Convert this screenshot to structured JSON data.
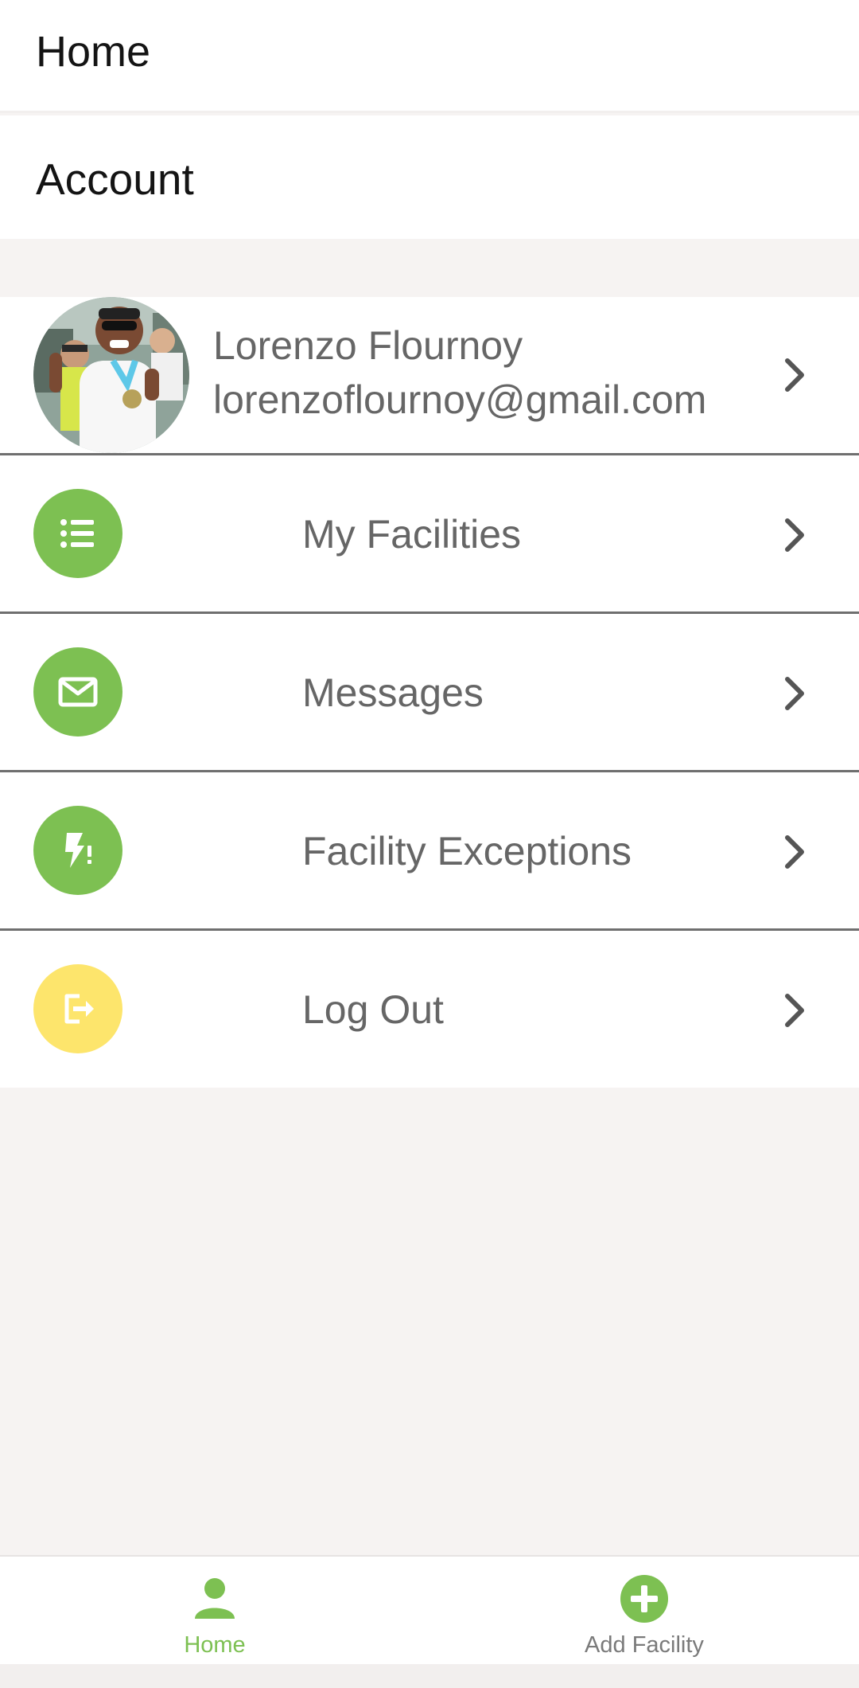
{
  "header": {
    "title": "Home"
  },
  "section": {
    "title": "Account"
  },
  "profile": {
    "name": "Lorenzo Flournoy",
    "email": "lorenzoflournoy@gmail.com"
  },
  "menu": [
    {
      "label": "My Facilities",
      "icon": "list-icon",
      "color": "#7dc052"
    },
    {
      "label": "Messages",
      "icon": "mail-icon",
      "color": "#7dc052"
    },
    {
      "label": "Facility Exceptions",
      "icon": "flash-alert-icon",
      "color": "#7dc052"
    },
    {
      "label": "Log Out",
      "icon": "logout-icon",
      "color": "#fde56c"
    }
  ],
  "bottom_nav": {
    "home_label": "Home",
    "add_label": "Add Facility",
    "active": "home",
    "active_color": "#7dc052"
  }
}
